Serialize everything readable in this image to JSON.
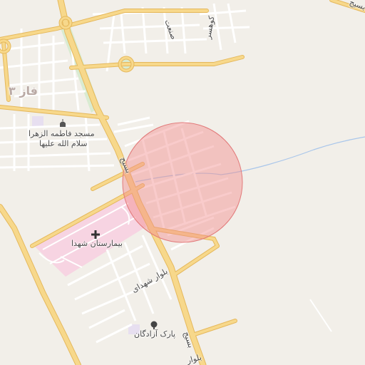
{
  "map": {
    "labels": {
      "district": "فاز ۳",
      "mosque_line1": "مسجد فاطمه الزهرا",
      "mosque_line2": "سلام الله علیها",
      "hospital": "بیمارستان شهدا",
      "boulevard": "بلوار شهدای",
      "park": "پارک آزادگان",
      "basij_upper": "بسیج",
      "basij_lower": "بسیج",
      "basij_top": "بسیج",
      "sanat": "صنعت",
      "koohsar": "کوهسر",
      "bottom_street": "بلوار"
    },
    "icons": {
      "mosque": "mosque-icon",
      "hospital": "hospital-cross-icon",
      "park": "tree-icon"
    },
    "colors": {
      "background": "#f2efe9",
      "major_road": "#f7d88b",
      "major_road_edge": "#e5b85c",
      "minor_road": "#ffffff",
      "hospital_area": "#f7d4e2",
      "park_area": "#d9ebd1",
      "accuracy_circle": "#f28b8b",
      "river": "#a9c6ea"
    },
    "accuracy_circle": {
      "visible": true
    }
  }
}
